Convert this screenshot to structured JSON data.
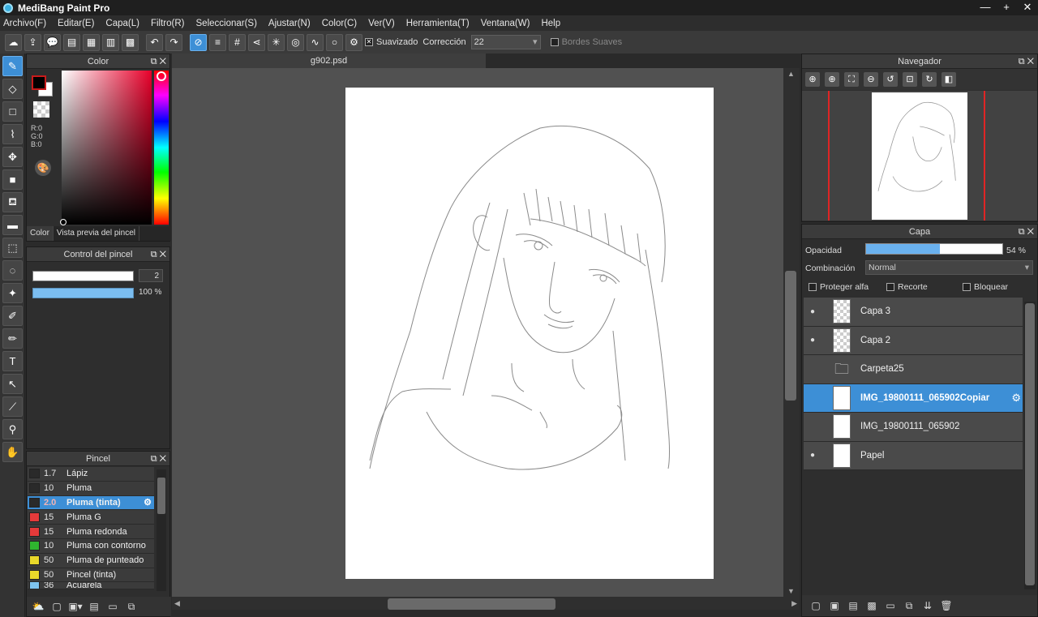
{
  "app": {
    "title": "MediBang Paint Pro",
    "win": {
      "min": "—",
      "max": "+",
      "close": "✕"
    }
  },
  "menu": [
    "Archivo(F)",
    "Editar(E)",
    "Capa(L)",
    "Filtro(R)",
    "Seleccionar(S)",
    "Ajustar(N)",
    "Color(C)",
    "Ver(V)",
    "Herramienta(T)",
    "Ventana(W)",
    "Help"
  ],
  "toolbar": {
    "smoothing_label": "Suavizado",
    "correction_label": "Corrección",
    "correction_value": "22",
    "soft_edges_label": "Bordes Suaves",
    "smoothing_check": "✕"
  },
  "color_panel": {
    "title": "Color",
    "r": "R:0",
    "g": "G:0",
    "b": "B:0",
    "tab_color": "Color",
    "tab_preview": "Vista previa del pincel",
    "fg": "#000000",
    "bg": "#ffffff"
  },
  "brush_control": {
    "title": "Control del pincel",
    "size": "2",
    "opacity": "100 %"
  },
  "brush_panel": {
    "title": "Pincel",
    "brushes": [
      {
        "size": "1.7",
        "name": "Lápiz",
        "color": "#2a2a2a"
      },
      {
        "size": "10",
        "name": "Pluma",
        "color": "#2a2a2a"
      },
      {
        "size": "2.0",
        "name": "Pluma (tinta)",
        "color": "#2a2a2a"
      },
      {
        "size": "15",
        "name": "Pluma G",
        "color": "#e53a3a"
      },
      {
        "size": "15",
        "name": "Pluma redonda",
        "color": "#e53a3a"
      },
      {
        "size": "10",
        "name": "Pluma con contorno",
        "color": "#2fb52f"
      },
      {
        "size": "50",
        "name": "Pluma de punteado",
        "color": "#e8d82a"
      },
      {
        "size": "50",
        "name": "Pincel (tinta)",
        "color": "#e8d82a"
      },
      {
        "size": "36",
        "name": "Acuarela",
        "color": "#7ec3ee"
      }
    ]
  },
  "document": {
    "tab": "g902.psd"
  },
  "navigator": {
    "title": "Navegador"
  },
  "layer_panel": {
    "title": "Capa",
    "opacity_label": "Opacidad",
    "opacity_value": "54 %",
    "blend_label": "Combinación",
    "blend_value": "Normal",
    "protect_alpha": "Proteger alfa",
    "clip": "Recorte",
    "lock": "Bloquear",
    "layers": [
      {
        "name": "Capa 3"
      },
      {
        "name": "Capa 2"
      },
      {
        "name": "Carpeta25"
      },
      {
        "name": "IMG_19800111_065902Copiar"
      },
      {
        "name": "IMG_19800111_065902"
      },
      {
        "name": "Papel"
      }
    ]
  }
}
